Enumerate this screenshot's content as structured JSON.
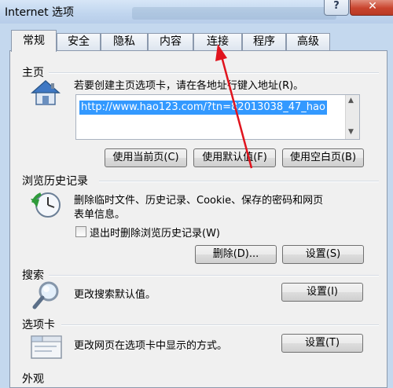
{
  "window": {
    "title": "Internet 选项",
    "help_label": "?",
    "close_label": "✕"
  },
  "tabs": [
    {
      "label": "常规",
      "active": true
    },
    {
      "label": "安全"
    },
    {
      "label": "隐私"
    },
    {
      "label": "内容"
    },
    {
      "label": "连接"
    },
    {
      "label": "程序"
    },
    {
      "label": "高级"
    }
  ],
  "homepage": {
    "section_title": "主页",
    "instruction": "若要创建主页选项卡，请在各地址行键入地址(R)。",
    "url_value": "http://www.hao123.com/?tn=82013038_47_hao",
    "buttons": {
      "use_current": "使用当前页(C)",
      "use_default": "使用默认值(F)",
      "use_blank": "使用空白页(B)"
    }
  },
  "history": {
    "section_title": "浏览历史记录",
    "description_line1": "删除临时文件、历史记录、Cookie、保存的密码和网页",
    "description_line2": "表单信息。",
    "checkbox_label": "退出时删除浏览历史记录(W)",
    "checkbox_checked": false,
    "delete_button": "删除(D)...",
    "settings_button": "设置(S)"
  },
  "search": {
    "section_title": "搜索",
    "description": "更改搜索默认值。",
    "settings_button": "设置(I)"
  },
  "tabs_section": {
    "section_title": "选项卡",
    "description": "更改网页在选项卡中显示的方式。",
    "settings_button": "设置(T)"
  },
  "appearance": {
    "section_title": "外观"
  },
  "colors": {
    "title_bar": "#c1d6ef",
    "panel": "#f0f0f0",
    "selection": "#3399ff",
    "annotation_arrow": "#e0141e",
    "close_button": "#c9452f"
  },
  "icons": {
    "homepage": "house-icon",
    "history": "clock-refresh-icon",
    "search": "magnifier-icon",
    "tabs": "tabbed-window-icon"
  }
}
